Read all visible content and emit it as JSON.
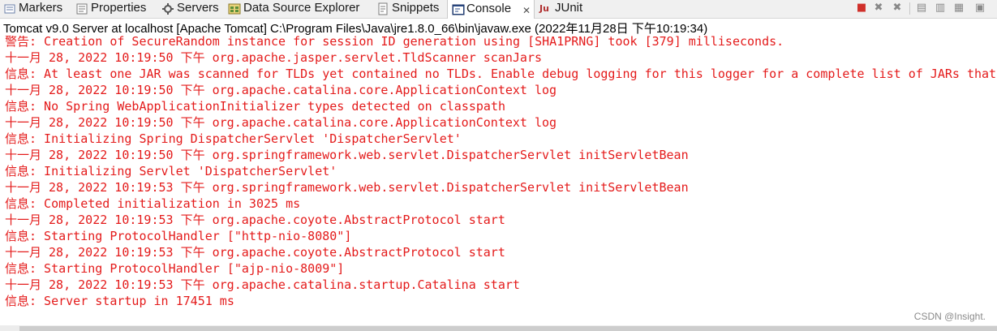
{
  "tabs": [
    {
      "label": "Markers",
      "icon": "markers-icon",
      "active": false
    },
    {
      "label": "Properties",
      "icon": "properties-icon",
      "active": false
    },
    {
      "label": "Servers",
      "icon": "servers-icon",
      "active": false
    },
    {
      "label": "Data Source Explorer",
      "icon": "data-source-icon",
      "active": false
    },
    {
      "label": "Snippets",
      "icon": "snippets-icon",
      "active": false
    },
    {
      "label": "Console",
      "icon": "console-icon",
      "active": true,
      "close": "✕"
    },
    {
      "label": "JUnit",
      "icon": "junit-icon",
      "active": false
    }
  ],
  "toolbar_icons": [
    "terminate-icon",
    "remove-launch-icon",
    "remove-all-icon",
    "scroll-lock-icon",
    "word-wrap-icon",
    "pin-console-icon",
    "display-console-icon"
  ],
  "colors": {
    "log_text": "#e41b1b",
    "tab_bg": "#f0f0f0"
  },
  "process_title": "Tomcat v9.0 Server at localhost [Apache Tomcat] C:\\Program Files\\Java\\jre1.8.0_66\\bin\\javaw.exe (2022年11月28日 下午10:19:34)",
  "console_lines": [
    "警告: Creation of SecureRandom instance for session ID generation using [SHA1PRNG] took [379] milliseconds.",
    "十一月 28, 2022 10:19:50 下午 org.apache.jasper.servlet.TldScanner scanJars",
    "信息: At least one JAR was scanned for TLDs yet contained no TLDs. Enable debug logging for this logger for a complete list of JARs that",
    "十一月 28, 2022 10:19:50 下午 org.apache.catalina.core.ApplicationContext log",
    "信息: No Spring WebApplicationInitializer types detected on classpath",
    "十一月 28, 2022 10:19:50 下午 org.apache.catalina.core.ApplicationContext log",
    "信息: Initializing Spring DispatcherServlet 'DispatcherServlet'",
    "十一月 28, 2022 10:19:50 下午 org.springframework.web.servlet.DispatcherServlet initServletBean",
    "信息: Initializing Servlet 'DispatcherServlet'",
    "十一月 28, 2022 10:19:53 下午 org.springframework.web.servlet.DispatcherServlet initServletBean",
    "信息: Completed initialization in 3025 ms",
    "十一月 28, 2022 10:19:53 下午 org.apache.coyote.AbstractProtocol start",
    "信息: Starting ProtocolHandler [\"http-nio-8080\"]",
    "十一月 28, 2022 10:19:53 下午 org.apache.coyote.AbstractProtocol start",
    "信息: Starting ProtocolHandler [\"ajp-nio-8009\"]",
    "十一月 28, 2022 10:19:53 下午 org.apache.catalina.startup.Catalina start",
    "信息: Server startup in 17451 ms"
  ],
  "watermark": "CSDN @Insight."
}
